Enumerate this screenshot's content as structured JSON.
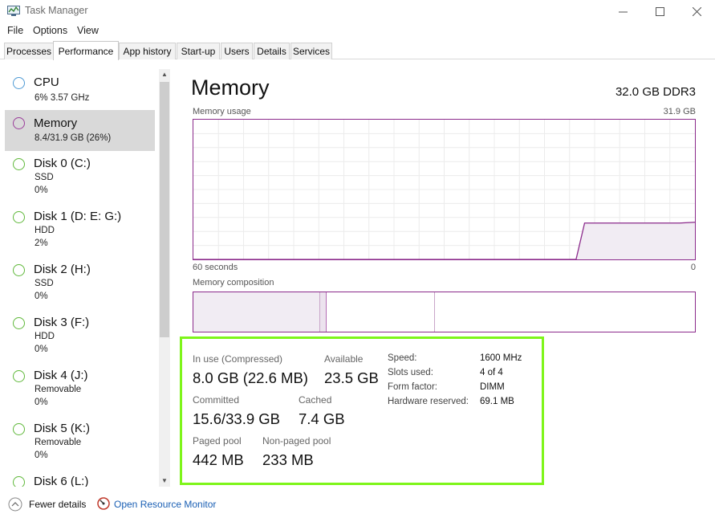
{
  "window": {
    "title": "Task Manager"
  },
  "menu": [
    "File",
    "Options",
    "View"
  ],
  "tabs": [
    "Processes",
    "Performance",
    "App history",
    "Start-up",
    "Users",
    "Details",
    "Services"
  ],
  "active_tab": "Performance",
  "sidebar": {
    "items": [
      {
        "name": "CPU",
        "sub1": "6%  3.57 GHz",
        "sub2": "",
        "color": "#4e9ad4"
      },
      {
        "name": "Memory",
        "sub1": "8.4/31.9 GB (26%)",
        "sub2": "",
        "color": "#9b3d9b",
        "selected": true
      },
      {
        "name": "Disk 0 (C:)",
        "sub1": "SSD",
        "sub2": "0%",
        "color": "#5fb83a"
      },
      {
        "name": "Disk 1 (D: E: G:)",
        "sub1": "HDD",
        "sub2": "2%",
        "color": "#5fb83a"
      },
      {
        "name": "Disk 2 (H:)",
        "sub1": "SSD",
        "sub2": "0%",
        "color": "#5fb83a"
      },
      {
        "name": "Disk 3 (F:)",
        "sub1": "HDD",
        "sub2": "0%",
        "color": "#5fb83a"
      },
      {
        "name": "Disk 4 (J:)",
        "sub1": "Removable",
        "sub2": "0%",
        "color": "#5fb83a"
      },
      {
        "name": "Disk 5 (K:)",
        "sub1": "Removable",
        "sub2": "0%",
        "color": "#5fb83a"
      },
      {
        "name": "Disk 6 (L:)",
        "sub1": "",
        "sub2": "",
        "color": "#5fb83a"
      }
    ]
  },
  "main": {
    "title": "Memory",
    "spec": "32.0 GB DDR3",
    "usage_label": "Memory usage",
    "usage_max": "31.9 GB",
    "time_left": "60 seconds",
    "time_right": "0",
    "composition_label": "Memory composition",
    "composition": {
      "in_use_fraction": 0.252,
      "modified_fraction": 0.013,
      "standby_fraction": 0.217
    },
    "usage_history_fraction": {
      "before": 0,
      "after": 0.26
    }
  },
  "stats": {
    "in_use_label": "In use (Compressed)",
    "in_use_value": "8.0 GB (22.6 MB)",
    "available_label": "Available",
    "available_value": "23.5 GB",
    "committed_label": "Committed",
    "committed_value": "15.6/33.9 GB",
    "cached_label": "Cached",
    "cached_value": "7.4 GB",
    "paged_label": "Paged pool",
    "paged_value": "442 MB",
    "nonpaged_label": "Non-paged pool",
    "nonpaged_value": "233 MB",
    "details": [
      {
        "key": "Speed:",
        "value": "1600 MHz"
      },
      {
        "key": "Slots used:",
        "value": "4 of 4"
      },
      {
        "key": "Form factor:",
        "value": "DIMM"
      },
      {
        "key": "Hardware reserved:",
        "value": "69.1 MB"
      }
    ]
  },
  "footer": {
    "fewer_details": "Fewer details",
    "open_monitor": "Open Resource Monitor"
  },
  "colors": {
    "memory": "#8b2a8b",
    "memory_fill": "#f1ecf3",
    "highlight": "#7ef51a",
    "link": "#1a5fb4"
  }
}
